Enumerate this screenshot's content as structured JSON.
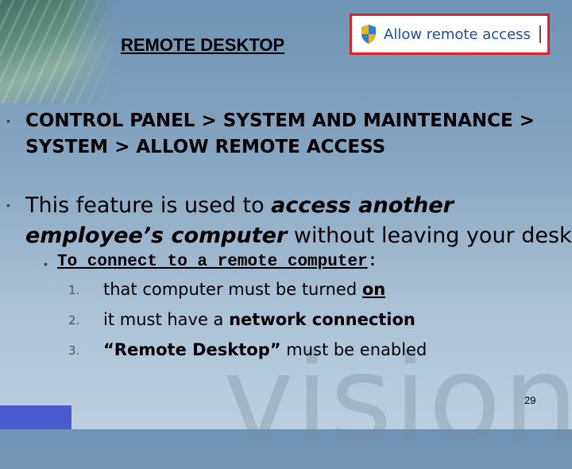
{
  "slide": {
    "title": "REMOTE DESKTOP",
    "page_number": "29",
    "watermark": "vision"
  },
  "callout": {
    "label": "Allow remote access",
    "icon": "shield-icon",
    "border_color": "#d8232a",
    "text_color": "#1d4f9c"
  },
  "bullets": {
    "path": "CONTROL PANEL  > SYSTEM AND MAINTENANCE > SYSTEM > ALLOW REMOTE ACCESS",
    "feature": {
      "before": "This feature is used to ",
      "em": "access another employee’s computer",
      "after": " without leaving your desk."
    },
    "sub": {
      "underlined": "To connect to a remote computer",
      "suffix": ":"
    },
    "steps": [
      {
        "num": "1.",
        "before": "that computer must be turned ",
        "emph": "on",
        "after": ""
      },
      {
        "num": "2.",
        "before": "it must have a ",
        "emph": "network connection",
        "after": ""
      },
      {
        "num": "3.",
        "before": "",
        "emph": "“Remote Desktop”",
        "after": " must be enabled"
      }
    ]
  }
}
